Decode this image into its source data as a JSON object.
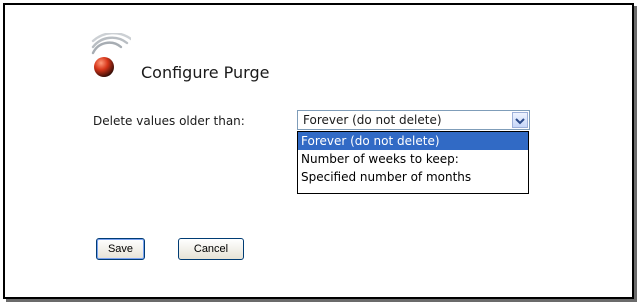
{
  "dialog": {
    "title": "Configure Purge",
    "logo_icon": "wireless-signal-icon"
  },
  "purge": {
    "label": "Delete values older than:",
    "selected_value": "Forever (do not delete)",
    "dropdown_icon": "chevron-down-icon",
    "options": [
      {
        "label": "Forever (do not delete)",
        "highlighted": true
      },
      {
        "label": "Number of weeks to keep:",
        "highlighted": false
      },
      {
        "label": "Specified number of months",
        "highlighted": false
      }
    ]
  },
  "actions": {
    "save_label": "Save",
    "cancel_label": "Cancel"
  },
  "colors": {
    "highlight": "#316ac5",
    "logo_ball": "#d8361a",
    "logo_waves": "#9aa0a6"
  }
}
